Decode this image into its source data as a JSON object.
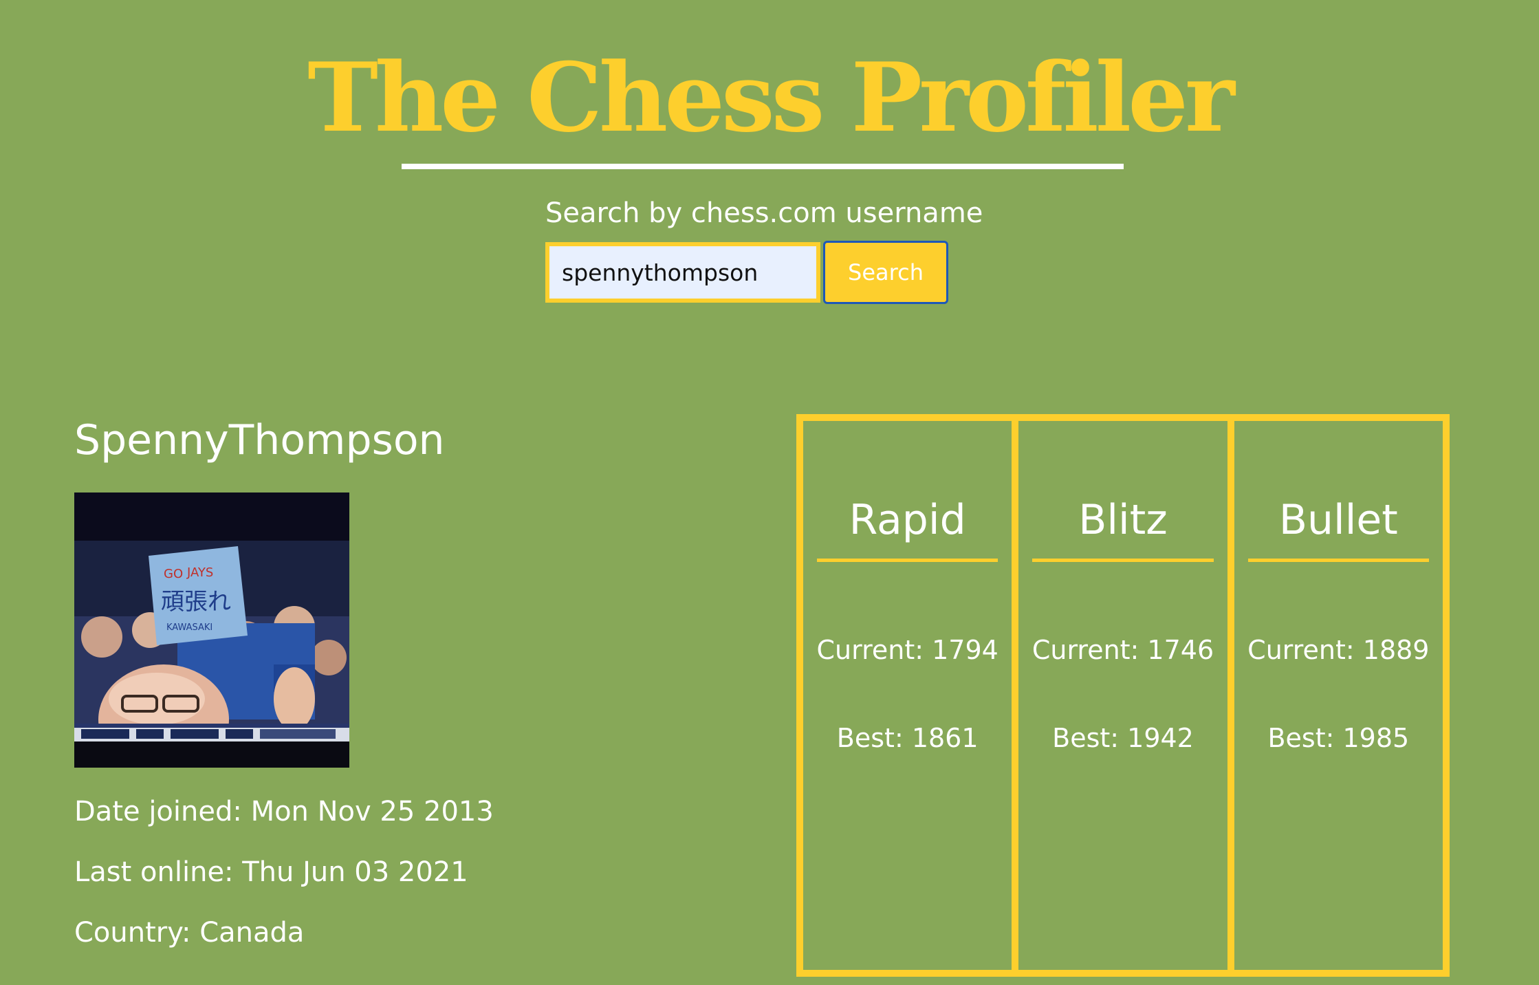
{
  "header": {
    "title": "The Chess Profiler"
  },
  "search": {
    "label": "Search by chess.com username",
    "value": "spennythompson",
    "button_label": "Search"
  },
  "profile": {
    "username": "SpennyThompson",
    "date_joined": "Date joined: Mon Nov 25 2013",
    "last_online": "Last online: Thu Jun 03 2021",
    "country": "Country: Canada"
  },
  "ratings": [
    {
      "title": "Rapid",
      "current": "Current: 1794",
      "best": "Best: 1861"
    },
    {
      "title": "Blitz",
      "current": "Current: 1746",
      "best": "Best: 1942"
    },
    {
      "title": "Bullet",
      "current": "Current: 1889",
      "best": "Best: 1985"
    }
  ],
  "colors": {
    "background": "#87a858",
    "accent": "#fdcf2d",
    "text": "#ffffff",
    "input_background": "#e8f0fe",
    "button_border": "#1d58b8"
  }
}
